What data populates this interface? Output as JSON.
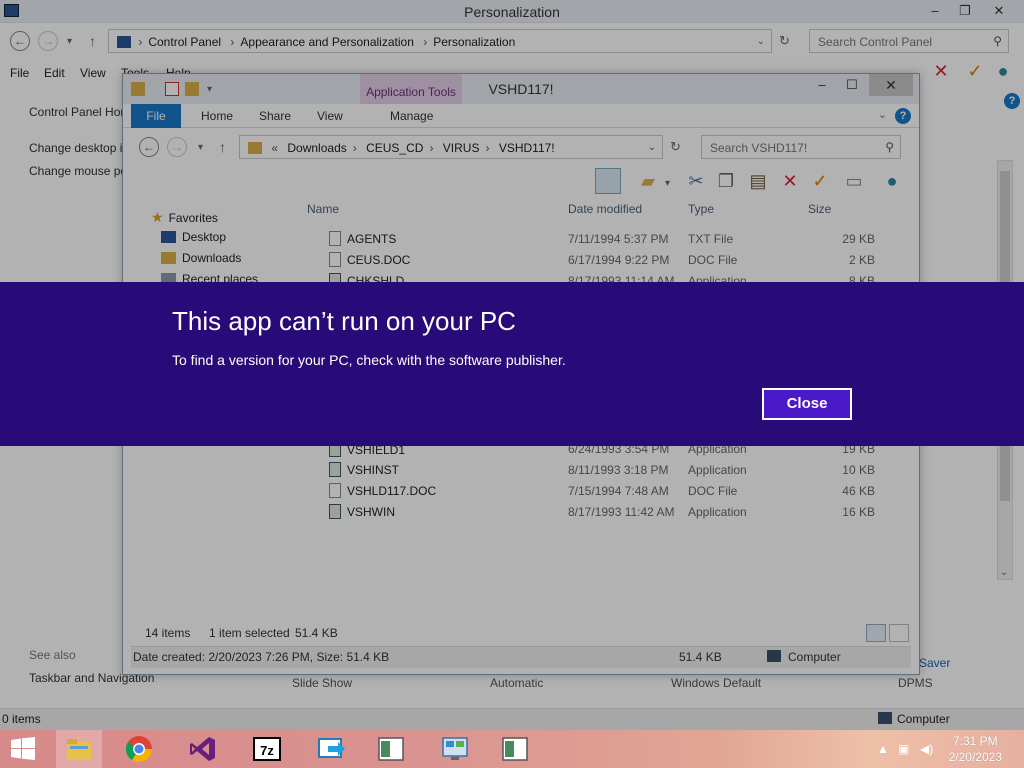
{
  "control_panel": {
    "title": "Personalization",
    "address": [
      "Control Panel",
      "Appearance and Personalization",
      "Personalization"
    ],
    "search_placeholder": "Search Control Panel",
    "menu": [
      "File",
      "Edit",
      "View",
      "Tools",
      "Help"
    ],
    "left_links": [
      "Control Panel Home",
      "Change desktop icons",
      "Change mouse pointers"
    ],
    "see_also": "See also",
    "taskbar_link": "Taskbar and Navigation",
    "bottom_items": [
      "Slide Show",
      "Automatic",
      "Windows Default",
      "DPMS"
    ],
    "saver_label": "Saver",
    "status_left": "0 items",
    "status_right": "Computer"
  },
  "explorer": {
    "title": "VSHD117!",
    "contextual_tab": "Application Tools",
    "ribbon_tabs": [
      "File",
      "Home",
      "Share",
      "View",
      "Manage"
    ],
    "address": [
      "Downloads",
      "CEUS_CD",
      "VIRUS",
      "VSHD117!"
    ],
    "address_prefix": "«",
    "search_placeholder": "Search VSHD117!",
    "columns": {
      "name": "Name",
      "date": "Date modified",
      "type": "Type",
      "size": "Size"
    },
    "nav": {
      "favorites": "Favorites",
      "items": [
        "Desktop",
        "Downloads",
        "Recent places"
      ]
    },
    "files_top": [
      {
        "name": "AGENTS",
        "date": "7/11/1994 5:37 PM",
        "type": "TXT File",
        "size": "29 KB",
        "icon": "doc"
      },
      {
        "name": "CEUS.DOC",
        "date": "6/17/1994 9:22 PM",
        "type": "DOC File",
        "size": "2 KB",
        "icon": "doc"
      },
      {
        "name": "CHKSHLD",
        "date": "8/17/1993 11:14 AM",
        "type": "Application",
        "size": "8 KB",
        "icon": "app"
      }
    ],
    "files_bottom": [
      {
        "name": "VSHIELD1",
        "date": "6/24/1993 3:54 PM",
        "type": "Application",
        "size": "19 KB",
        "icon": "app"
      },
      {
        "name": "VSHINST",
        "date": "8/11/1993 3:18 PM",
        "type": "Application",
        "size": "10 KB",
        "icon": "app"
      },
      {
        "name": "VSHLD117.DOC",
        "date": "7/15/1994 7:48 AM",
        "type": "DOC File",
        "size": "46 KB",
        "icon": "doc"
      },
      {
        "name": "VSHWIN",
        "date": "8/17/1993 11:42 AM",
        "type": "Application",
        "size": "16 KB",
        "icon": "app"
      }
    ],
    "status": {
      "count": "14 items",
      "selected": "1 item selected",
      "selected_size": "51.4 KB"
    },
    "details": {
      "info": "Date created: 2/20/2023 7:26 PM, Size: 51.4 KB",
      "size": "51.4 KB",
      "location": "Computer"
    }
  },
  "banner": {
    "title": "This app can’t run on your PC",
    "message": "To find a version for your PC, check with the software publisher.",
    "close_label": "Close",
    "color": "#280b78"
  },
  "taskbar": {
    "apps": [
      "start-icon",
      "file-explorer-icon",
      "chrome-icon",
      "visual-studio-icon",
      "7zip-icon",
      "remote-app-icon",
      "app-window-icon",
      "control-panel-icon",
      "app-window-icon"
    ],
    "time": "7:31 PM",
    "date": "2/20/2023"
  }
}
